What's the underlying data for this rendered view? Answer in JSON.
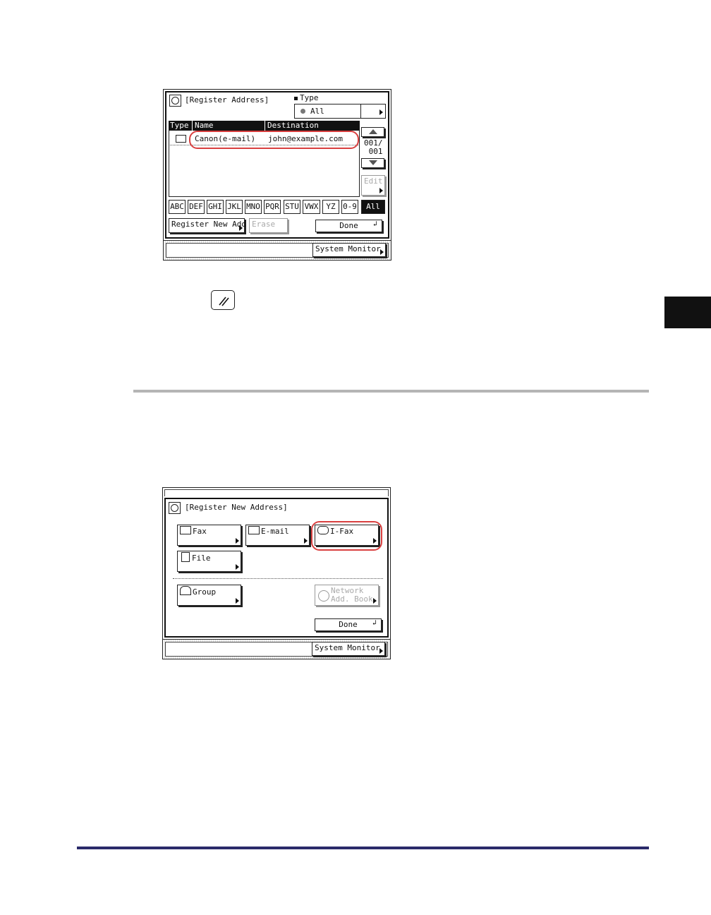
{
  "screen1": {
    "title": "[Register Address]",
    "type_label": "Type",
    "type_value": "All",
    "columns": {
      "type": "Type",
      "name": "Name",
      "destination": "Destination"
    },
    "row": {
      "name": "Canon(e-mail)",
      "destination": "john@example.com"
    },
    "page_counter": "001/\n 001",
    "edit_label": "Edit",
    "letters": [
      "ABC",
      "DEF",
      "GHI",
      "JKL",
      "MNO",
      "PQR",
      "STU",
      "VWX",
      "YZ",
      "0-9",
      "All"
    ],
    "register_new_label": "Register New Add",
    "erase_label": "Erase",
    "done_label": "Done",
    "system_monitor_label": "System Monitor"
  },
  "screen2": {
    "title": "[Register New Address]",
    "fax_label": "Fax",
    "email_label": "E-mail",
    "ifax_label": "I-Fax",
    "file_label": "File",
    "group_label": "Group",
    "network_line1": "Network",
    "network_line2": "Add. Book",
    "done_label": "Done",
    "system_monitor_label": "System Monitor"
  },
  "colors": {
    "highlight": "#d94040",
    "rule": "#b5b5b5",
    "footer_rule": "#2a2a6a",
    "tab": "#111111"
  }
}
